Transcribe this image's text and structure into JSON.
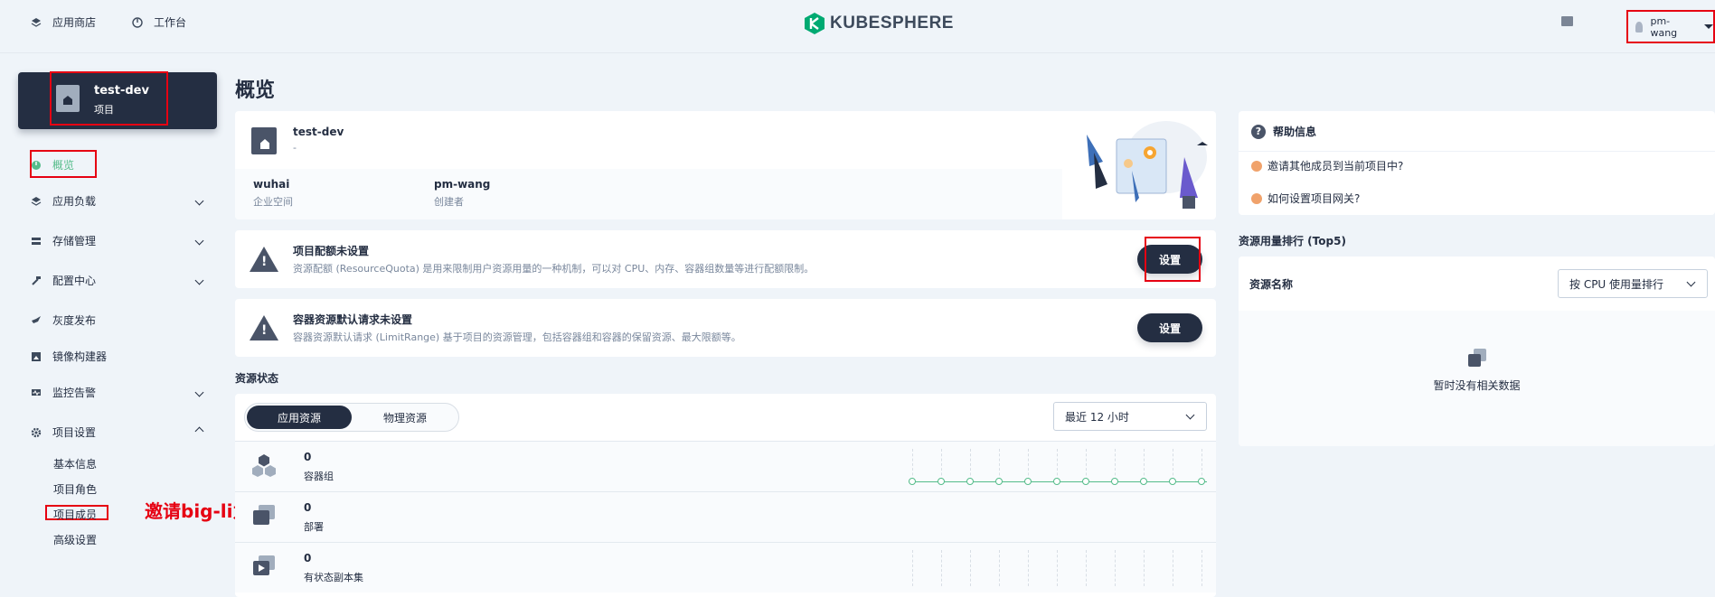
{
  "topbar": {
    "app_store": "应用商店",
    "workbench": "工作台",
    "logo_text": "KUBESPHERE",
    "username": "pm-wang"
  },
  "project": {
    "name": "test-dev",
    "type": "项目"
  },
  "sidebar": {
    "overview": "概览",
    "app_workloads": "应用负载",
    "storage": "存储管理",
    "config_center": "配置中心",
    "grayscale": "灰度发布",
    "image_builder": "镜像构建器",
    "monitoring": "监控告警",
    "project_settings": "项目设置",
    "sub": {
      "basic_info": "基本信息",
      "roles": "项目角色",
      "members": "项目成员",
      "advanced": "高级设置"
    }
  },
  "annotation": "邀请big-li为操作者",
  "page_title": "概览",
  "overview": {
    "name": "test-dev",
    "desc": "-",
    "workspace_value": "wuhai",
    "workspace_key": "企业空间",
    "creator_value": "pm-wang",
    "creator_key": "创建者"
  },
  "quota_alert": {
    "title": "项目配额未设置",
    "desc": "资源配额 (ResourceQuota) 是用来限制用户资源用量的一种机制，可以对 CPU、内存、容器组数量等进行配额限制。",
    "button": "设置"
  },
  "limit_alert": {
    "title": "容器资源默认请求未设置",
    "desc": "容器资源默认请求 (LimitRange) 基于项目的资源管理，包括容器组和容器的保留资源、最大限额等。",
    "button": "设置"
  },
  "resource_status": {
    "title": "资源状态",
    "tab_app": "应用资源",
    "tab_physical": "物理资源",
    "time_range": "最近 12 小时",
    "rows": [
      {
        "value": "0",
        "label": "容器组"
      },
      {
        "value": "0",
        "label": "部署"
      },
      {
        "value": "0",
        "label": "有状态副本集"
      }
    ]
  },
  "help": {
    "title": "帮助信息",
    "link1": "邀请其他成员到当前项目中?",
    "link2": "如何设置项目网关?"
  },
  "ranking": {
    "title": "资源用量排行 (Top5)",
    "col_name": "资源名称",
    "sort_select": "按 CPU 使用量排行",
    "empty": "暂时没有相关数据"
  },
  "colors": {
    "dark": "#242e42",
    "accent_green": "#55bc8a",
    "annotation_red": "#e60012",
    "bg": "#eff4f9"
  }
}
